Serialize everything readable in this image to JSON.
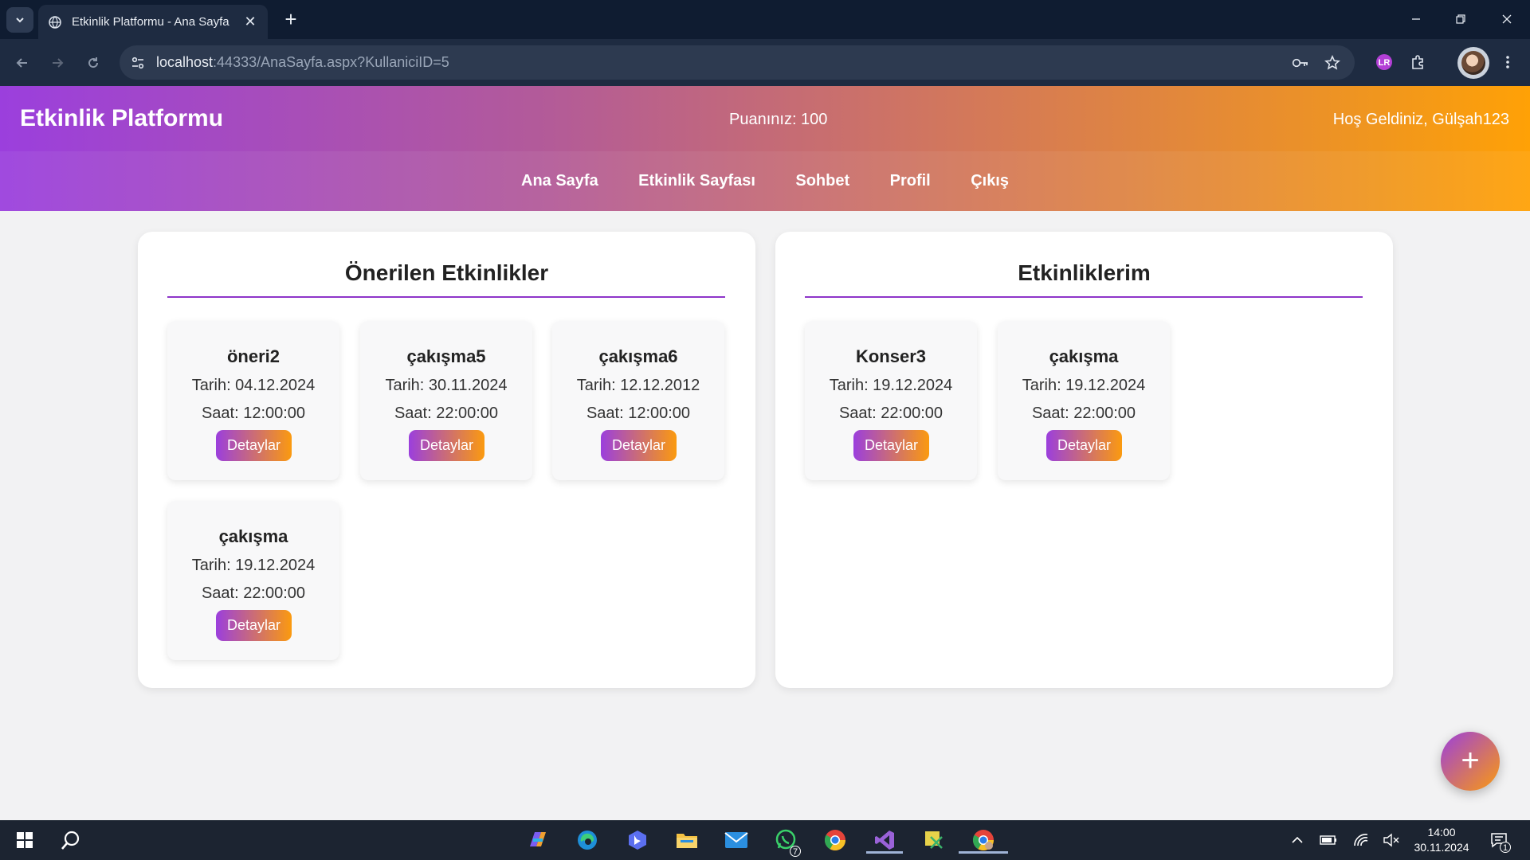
{
  "browser": {
    "tab_title": "Etkinlik Platformu - Ana Sayfa",
    "url_host": "localhost",
    "url_rest": ":44333/AnaSayfa.aspx?KullaniciID=5"
  },
  "header": {
    "brand": "Etkinlik Platformu",
    "points": "Puanınız: 100",
    "welcome": "Hoş Geldiniz, Gülşah123"
  },
  "nav": {
    "items": [
      "Ana Sayfa",
      "Etkinlik Sayfası",
      "Sohbet",
      "Profil",
      "Çıkış"
    ]
  },
  "recommended": {
    "title": "Önerilen Etkinlikler",
    "cards": [
      {
        "name": "öneri2",
        "date": "Tarih: 04.12.2024",
        "time": "Saat: 12:00:00",
        "button": "Detaylar"
      },
      {
        "name": "çakışma5",
        "date": "Tarih: 30.11.2024",
        "time": "Saat: 22:00:00",
        "button": "Detaylar"
      },
      {
        "name": "çakışma6",
        "date": "Tarih: 12.12.2012",
        "time": "Saat: 12:00:00",
        "button": "Detaylar"
      },
      {
        "name": "çakışma",
        "date": "Tarih: 19.12.2024",
        "time": "Saat: 22:00:00",
        "button": "Detaylar"
      }
    ]
  },
  "my_events": {
    "title": "Etkinliklerim",
    "cards": [
      {
        "name": "Konser3",
        "date": "Tarih: 19.12.2024",
        "time": "Saat: 22:00:00",
        "button": "Detaylar"
      },
      {
        "name": "çakışma",
        "date": "Tarih: 19.12.2024",
        "time": "Saat: 22:00:00",
        "button": "Detaylar"
      }
    ]
  },
  "fab": {
    "symbol": "+"
  },
  "taskbar": {
    "whatsapp_badge": "7",
    "clock_time": "14:00",
    "clock_date": "30.11.2024",
    "notification_count": "1"
  },
  "colors": {
    "header_gradient_start": "#9b3fdd",
    "header_gradient_end": "#ffa106",
    "panel_rule": "#8e35c9"
  }
}
